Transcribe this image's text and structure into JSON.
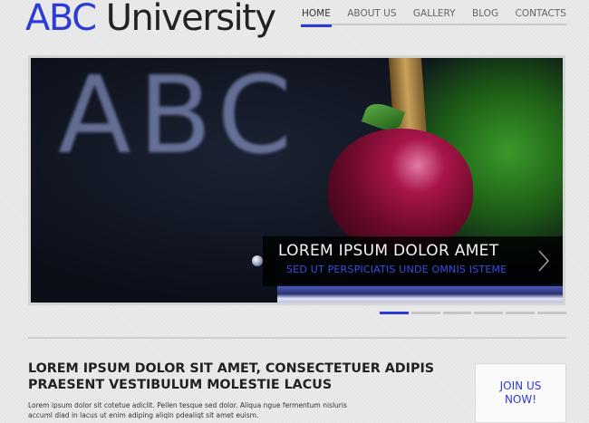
{
  "header": {
    "logo_brand": "ABC",
    "logo_rest": " University"
  },
  "nav": {
    "items": [
      {
        "label": "HOME",
        "active": true
      },
      {
        "label": "ABOUT US",
        "active": false
      },
      {
        "label": "GALLERY",
        "active": false
      },
      {
        "label": "BLOG",
        "active": false
      },
      {
        "label": "CONTACTS",
        "active": false
      }
    ]
  },
  "slider": {
    "image_text": "ABC",
    "caption_title": "LOREM IPSUM DOLOR AMET",
    "caption_subtitle": "SED UT PERSPICIATIS UNDE OMNIS ISTEME",
    "next_icon": "chevron-right-icon",
    "slide_count": 6,
    "active_slide": 1
  },
  "main": {
    "heading": "LOREM IPSUM DOLOR SIT AMET, CONSECTETUER ADIPIS PRAESENT VESTIBULUM MOLESTIE LACUS",
    "body": "Lorem ipsum dolor sit cotetue adiclit. Pellen tesque sed dolor. Aliqua ngue fermentum nisluris accuml diad in lacus ut enim adiping aliqln pdealiqt sit amet euism.",
    "cta_label": "JOIN US NOW!"
  },
  "colors": {
    "accent": "#2d3bd6",
    "background": "#e6e6e6",
    "caption_bg": "#000000"
  }
}
